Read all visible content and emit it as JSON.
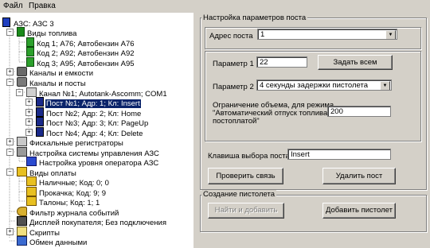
{
  "menu": {
    "file": "Файл",
    "edit": "Правка"
  },
  "tree": {
    "root": "АЗС: АЗС 3",
    "fuel_types": "Виды топлива",
    "fuel_items": [
      "Код 1; А76; Автобензин А76",
      "Код 2; А92; Автобензин А92",
      "Код 3; А95; Автобензин А95"
    ],
    "channels_tanks": "Каналы и емкости",
    "channels_posts": "Каналы и посты",
    "channel1": "Канал №1; Autotank-Ascomm; COM1",
    "posts": [
      "Пост №1; Адр: 1; Кл: Insert",
      "Пост №2; Адр: 2; Кл: Home",
      "Пост №3; Адр: 3; Кл: PageUp",
      "Пост №4; Адр: 4; Кл: Delete"
    ],
    "fiscal": "Фискальные регистраторы",
    "mgmt": "Настройка системы управления АЗС",
    "operator_level": "Настройка уровня оператора АЗС",
    "payment": "Виды оплаты",
    "payment_items": [
      "Наличные; Код: 0; 0",
      "Прокачка; Код: 9; 9",
      "Талоны; Код: 1; 1"
    ],
    "log_filter": "Фильтр журнала событий",
    "display": "Дисплей покупателя; Без подключения",
    "scripts": "Скрипты",
    "exchange": "Обмен данными"
  },
  "post_settings": {
    "title": "Настройка параметров поста",
    "address_label": "Адрес поста",
    "address_value": "1",
    "param1_label": "Параметр 1",
    "param1_value": "22",
    "set_all_button": "Задать всем",
    "param2_label": "Параметр 2",
    "param2_value": "4 секунды  задержки пистолета",
    "limit_label_1": "Ограничение объема, для режима",
    "limit_label_2": "\"Автоматический отпуск топлива с",
    "limit_label_3": "постоплатой\"",
    "limit_value": "200",
    "key_label": "Клавиша выбора поста",
    "key_value": "Insert",
    "check_button": "Проверить связь",
    "delete_button": "Удалить пост"
  },
  "gun_create": {
    "title": "Создание пистолета",
    "find_add_button": "Найти и добавить",
    "add_button": "Добавить пистолет"
  },
  "colors": {
    "selection": "#0a246a",
    "face": "#d4d0c8"
  }
}
